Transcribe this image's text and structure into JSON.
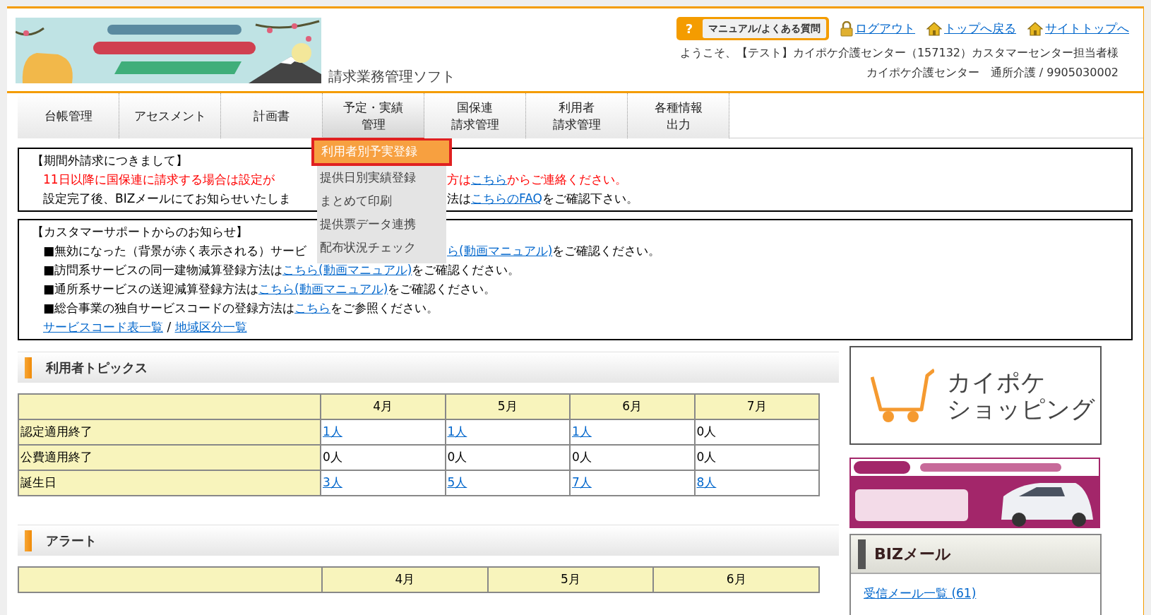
{
  "header": {
    "app_title": "請求業務管理ソフト",
    "help_button": {
      "icon": "?",
      "label": "マニュアル/よくある質問"
    },
    "links": [
      {
        "kind": "lock",
        "label": "ログアウト"
      },
      {
        "kind": "home",
        "label": "トップへ戻る"
      },
      {
        "kind": "home",
        "label": "サイトトップへ"
      }
    ],
    "welcome": "ようこそ、【テスト】カイポケ介護センター（157132）カスタマーセンター担当者様",
    "office": "カイポケ介護センター　通所介護 / 9905030002"
  },
  "nav": [
    {
      "lines": [
        "台帳管理"
      ],
      "open": false
    },
    {
      "lines": [
        "アセスメント"
      ],
      "open": false
    },
    {
      "lines": [
        "計画書"
      ],
      "open": false
    },
    {
      "lines": [
        "予定・実績",
        "管理"
      ],
      "open": true
    },
    {
      "lines": [
        "国保連",
        "請求管理"
      ],
      "open": false
    },
    {
      "lines": [
        "利用者",
        "請求管理"
      ],
      "open": false
    },
    {
      "lines": [
        "各種情報",
        "出力"
      ],
      "open": false
    }
  ],
  "dropdown": [
    {
      "label": "利用者別予実登録",
      "selected": true
    },
    {
      "label": "提供日別実績登録",
      "selected": false
    },
    {
      "label": "まとめて印刷",
      "selected": false
    },
    {
      "label": "提供票データ連携",
      "selected": false
    },
    {
      "label": "配布状況チェック",
      "selected": false
    }
  ],
  "notices": [
    {
      "title": "【期間外請求につきまして】",
      "lines": [
        {
          "color": "#ff0000",
          "left": [
            {
              "text": "11日以降に国保連に請求する場合は設定が",
              "link": false
            }
          ],
          "right": [
            {
              "text": "方は",
              "link": false
            },
            {
              "text": "こちら",
              "link": true
            },
            {
              "text": "からご連絡ください。",
              "link": false
            }
          ]
        },
        {
          "color": "#000000",
          "left": [
            {
              "text": "設定完了後、BIZメールにてお知らせいたしま",
              "link": false
            }
          ],
          "right": [
            {
              "text": "法は",
              "link": false
            },
            {
              "text": "こちらのFAQ",
              "link": true
            },
            {
              "text": "をご確認下さい。",
              "link": false
            }
          ]
        }
      ]
    },
    {
      "title": "【カスタマーサポートからのお知らせ】",
      "lines": [
        {
          "color": "#000000",
          "left": [
            {
              "text": "■無効になった（背景が赤く表示される）サービ",
              "link": false
            }
          ],
          "right": [
            {
              "text": "ら(動画マニュアル)",
              "link": true
            },
            {
              "text": "をご確認ください。",
              "link": false
            }
          ]
        },
        {
          "color": "#000000",
          "left": [
            {
              "text": "■訪問系サービスの同一建物減算登録方法は",
              "link": false
            },
            {
              "text": "こちら(動画マニュアル)",
              "link": true
            },
            {
              "text": "をご確認ください。",
              "link": false
            }
          ]
        },
        {
          "color": "#000000",
          "left": [
            {
              "text": "■通所系サービスの送迎減算登録方法は",
              "link": false
            },
            {
              "text": "こちら(動画マニュアル)",
              "link": true
            },
            {
              "text": "をご確認ください。",
              "link": false
            }
          ]
        },
        {
          "color": "#000000",
          "left": [
            {
              "text": "■総合事業の独自サービスコードの登録方法は",
              "link": false
            },
            {
              "text": "こちら",
              "link": true
            },
            {
              "text": "をご参照ください。",
              "link": false
            }
          ]
        },
        {
          "color": "#000000",
          "left": [
            {
              "text": "サービスコード表一覧",
              "link": true
            },
            {
              "text": " / ",
              "link": false
            },
            {
              "text": "地域区分一覧",
              "link": true
            }
          ]
        }
      ]
    }
  ],
  "topics": {
    "title": "利用者トピックス",
    "columns": [
      "4月",
      "5月",
      "6月",
      "7月"
    ],
    "rows": [
      {
        "label": "認定適用終了",
        "cells": [
          {
            "text": "1人",
            "link": true
          },
          {
            "text": "1人",
            "link": true
          },
          {
            "text": "1人",
            "link": true
          },
          {
            "text": "0人",
            "link": false
          }
        ]
      },
      {
        "label": "公費適用終了",
        "cells": [
          {
            "text": "0人",
            "link": false
          },
          {
            "text": "0人",
            "link": false
          },
          {
            "text": "0人",
            "link": false
          },
          {
            "text": "0人",
            "link": false
          }
        ]
      },
      {
        "label": "誕生日",
        "cells": [
          {
            "text": "3人",
            "link": true
          },
          {
            "text": "5人",
            "link": true
          },
          {
            "text": "7人",
            "link": true
          },
          {
            "text": "8人",
            "link": true
          }
        ]
      }
    ]
  },
  "alerts": {
    "title": "アラート",
    "columns": [
      "4月",
      "5月",
      "6月"
    ]
  },
  "sidebar": {
    "shop_logo": [
      "カイポケ",
      "ショッピング"
    ],
    "mail": {
      "title": "BIZメール",
      "link": "受信メール一覧 (61)"
    }
  }
}
